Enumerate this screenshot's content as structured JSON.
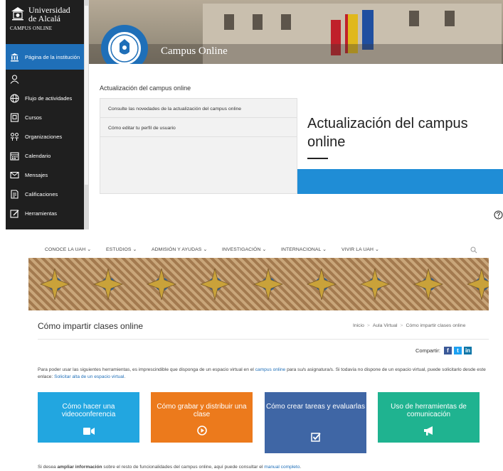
{
  "campus": {
    "logo": {
      "line1": "Universidad",
      "line2": "de Alcalá",
      "subtitle": "CAMPUS ONLINE"
    },
    "sidebar": [
      {
        "label": "Página de la institución",
        "icon": "institution-icon",
        "active": true
      },
      {
        "label": "",
        "icon": "user-icon"
      },
      {
        "label": "Flujo de actividades",
        "icon": "globe-icon"
      },
      {
        "label": "Cursos",
        "icon": "courses-icon"
      },
      {
        "label": "Organizaciones",
        "icon": "organizations-icon"
      },
      {
        "label": "Calendario",
        "icon": "calendar-icon"
      },
      {
        "label": "Mensajes",
        "icon": "mail-icon"
      },
      {
        "label": "Calificaciones",
        "icon": "grades-icon"
      },
      {
        "label": "Herramientas",
        "icon": "tools-icon"
      }
    ],
    "banner_title": "Campus Online",
    "section_title": "Actualización del campus online",
    "panel_items": [
      "Consulte las novedades de la actualización del campus online",
      "Cómo editar tu perfil de usuario"
    ],
    "feature_title": "Actualización del campus online",
    "colors": {
      "sidebar": "#1f1f1f",
      "active": "#1f6fb8",
      "feature_bar": "#1f8dd6"
    }
  },
  "uah": {
    "nav": [
      "CONOCE LA UAH",
      "ESTUDIOS",
      "ADMISIÓN Y AYUDAS",
      "INVESTIGACIÓN",
      "INTERNACIONAL",
      "VIVIR LA UAH"
    ],
    "page_title": "Cómo impartir clases online",
    "breadcrumb": [
      "Inicio",
      "Aula Virtual",
      "Cómo impartir clases online"
    ],
    "share_label": "Compartir:",
    "intro": {
      "p1": "Para poder usar las siguientes herramientas, es imprescindible que disponga de un espacio virtual en el",
      "link1": "campus online",
      "p2": "para su/s asignatura/s. Si todavía no dispone de un espacio virtual, puede solicitarlo desde este enlace:",
      "link2": "Solicitar alta de un espacio virtual",
      "p3": "."
    },
    "cards": [
      {
        "title": "Cómo hacer una videoconferencia",
        "icon": "video-camera-icon",
        "color": "#22a6e0"
      },
      {
        "title": "Cómo grabar y distribuir una clase",
        "icon": "play-icon",
        "color": "#ec7a1c"
      },
      {
        "title": "Cómo crear tareas y evaluarlas",
        "icon": "checkbox-icon",
        "color": "#3f66a5"
      },
      {
        "title": "Uso de herramientas de comunicación",
        "icon": "megaphone-icon",
        "color": "#1fb390"
      }
    ],
    "footer": {
      "p1": "Si desea",
      "bold": "ampliar información",
      "p2": "sobre el resto de funcionalidades del campus online, aquí puede consultar el",
      "link": "manual completo",
      "p3": "."
    }
  }
}
